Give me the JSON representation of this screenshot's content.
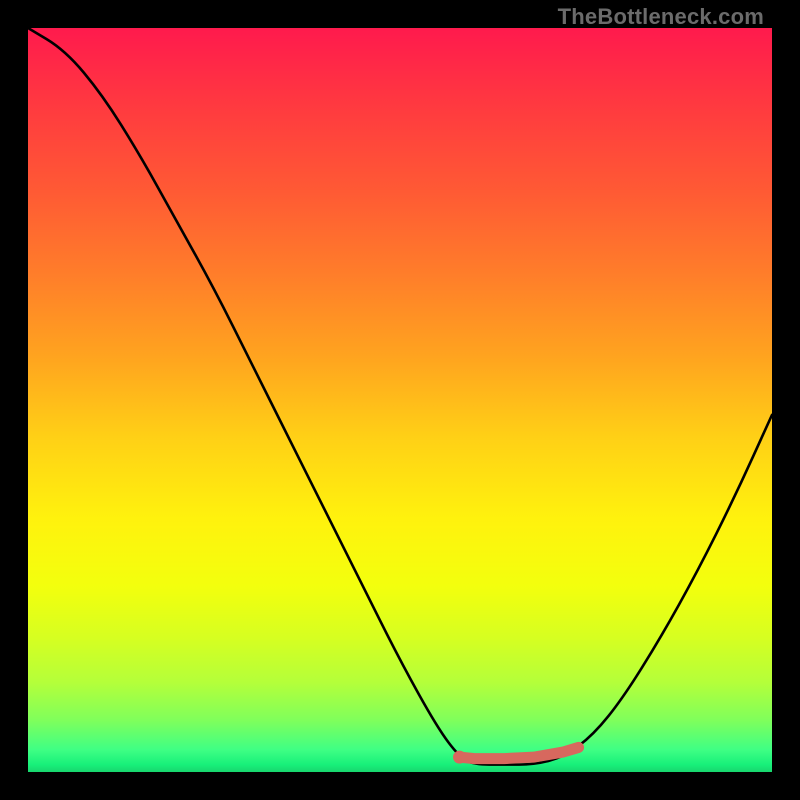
{
  "watermark": "TheBottleneck.com",
  "chart_data": {
    "type": "line",
    "title": "",
    "xlabel": "",
    "ylabel": "",
    "xlim": [
      0,
      1
    ],
    "ylim": [
      0,
      1
    ],
    "series": [
      {
        "name": "bottleneck-curve",
        "color": "#000000",
        "x": [
          0.0,
          0.05,
          0.1,
          0.15,
          0.2,
          0.25,
          0.3,
          0.35,
          0.4,
          0.45,
          0.5,
          0.55,
          0.58,
          0.6,
          0.64,
          0.68,
          0.72,
          0.76,
          0.8,
          0.85,
          0.9,
          0.95,
          1.0
        ],
        "y": [
          1.0,
          0.97,
          0.91,
          0.83,
          0.74,
          0.65,
          0.55,
          0.45,
          0.35,
          0.25,
          0.15,
          0.06,
          0.02,
          0.01,
          0.01,
          0.01,
          0.02,
          0.05,
          0.1,
          0.18,
          0.27,
          0.37,
          0.48
        ]
      },
      {
        "name": "recommended-range",
        "color": "#d7685e",
        "x": [
          0.58,
          0.6,
          0.64,
          0.68,
          0.72,
          0.74
        ],
        "y": [
          0.02,
          0.018,
          0.018,
          0.02,
          0.027,
          0.033
        ]
      }
    ],
    "marker": {
      "name": "min-point",
      "color": "#d7685e",
      "x": 0.58,
      "y": 0.02
    },
    "gradient_stops": [
      {
        "pos": 0.0,
        "color": "#ff1a4d"
      },
      {
        "pos": 0.11,
        "color": "#ff3b3f"
      },
      {
        "pos": 0.22,
        "color": "#ff5a34"
      },
      {
        "pos": 0.33,
        "color": "#ff7d2a"
      },
      {
        "pos": 0.44,
        "color": "#ffa31f"
      },
      {
        "pos": 0.55,
        "color": "#ffd016"
      },
      {
        "pos": 0.66,
        "color": "#fff20d"
      },
      {
        "pos": 0.75,
        "color": "#f3ff0d"
      },
      {
        "pos": 0.82,
        "color": "#d6ff21"
      },
      {
        "pos": 0.88,
        "color": "#b4ff3a"
      },
      {
        "pos": 0.93,
        "color": "#80ff5b"
      },
      {
        "pos": 0.97,
        "color": "#3fff84"
      },
      {
        "pos": 0.99,
        "color": "#18f07a"
      },
      {
        "pos": 1.0,
        "color": "#18d66e"
      }
    ]
  }
}
